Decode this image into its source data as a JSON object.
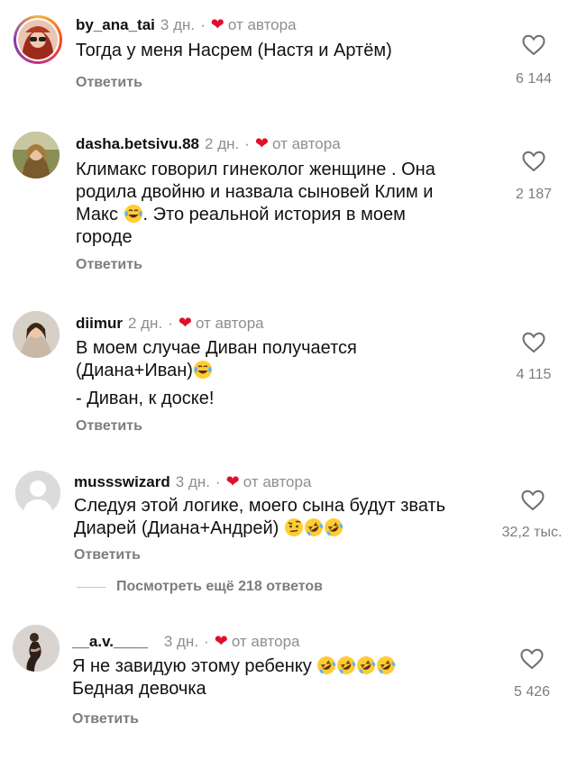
{
  "comments": [
    {
      "username": "by_ana_tai",
      "time": "3 дн.",
      "by_author": "от автора",
      "text_lines": [
        "Тогда у меня Насрем (Настя и Артём)"
      ],
      "reply": "Ответить",
      "likes": "6 144"
    },
    {
      "username": "dasha.betsivu.88",
      "time": "2 дн.",
      "by_author": "от автора",
      "text_lines": [
        "Климакс говорил гинеколог женщине . Она",
        "родила двойню и назвала сыновей Клим и",
        "Макс",
        ". Это реальной история в моем",
        "городе"
      ],
      "reply": "Ответить",
      "likes": "2 187"
    },
    {
      "username": "diimur",
      "time": "2 дн.",
      "by_author": "от автора",
      "text_lines": [
        "В моем случае Диван получается",
        "(Диана+Иван)",
        "- Диван, к доске!"
      ],
      "reply": "Ответить",
      "likes": "4 115"
    },
    {
      "username": "mussswizard",
      "time": "3 дн.",
      "by_author": "от автора",
      "text_lines": [
        "Следуя этой логике, моего сына будут звать",
        "Диарей (Диана+Андрей)"
      ],
      "reply": "Ответить",
      "likes": "32,2 тыс."
    },
    {
      "username": "__a.v.____",
      "time": "3 дн.",
      "by_author": "от автора",
      "text_lines": [
        "Я не завидую этому ребенку",
        "Бедная девочка"
      ],
      "reply": "Ответить",
      "likes": "5 426"
    }
  ],
  "view_more": "Посмотреть ещё 218 ответов",
  "icons": {
    "heart_author": "red-heart-icon",
    "like": "heart-outline-icon",
    "emoji_joy": "face-tears-of-joy-emoji",
    "emoji_rofl": "rolling-on-floor-laughing-emoji",
    "emoji_raised_eyebrow": "raised-eyebrow-emoji"
  },
  "colors": {
    "author_heart": "#e0102a",
    "muted": "#8e8e8e"
  }
}
